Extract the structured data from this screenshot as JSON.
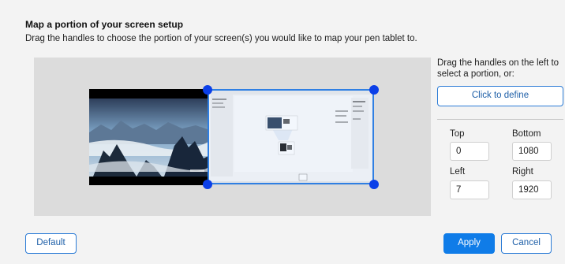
{
  "header": {
    "title": "Map a portion of your screen setup",
    "subtitle": "Drag the handles to choose the portion of your screen(s) you would like to map your pen tablet to."
  },
  "side_panel": {
    "hint": "Drag the handles on the left to select a portion, or:",
    "define_label": "Click to define"
  },
  "coords": {
    "top_label": "Top",
    "top_value": "0",
    "bottom_label": "Bottom",
    "bottom_value": "1080",
    "left_label": "Left",
    "left_value": "7",
    "right_label": "Right",
    "right_value": "1920"
  },
  "footer": {
    "default_label": "Default",
    "apply_label": "Apply",
    "cancel_label": "Cancel"
  },
  "colors": {
    "accent": "#0f7ce8",
    "handle": "#0b3fe8",
    "selection_border": "#2f7fe3"
  }
}
